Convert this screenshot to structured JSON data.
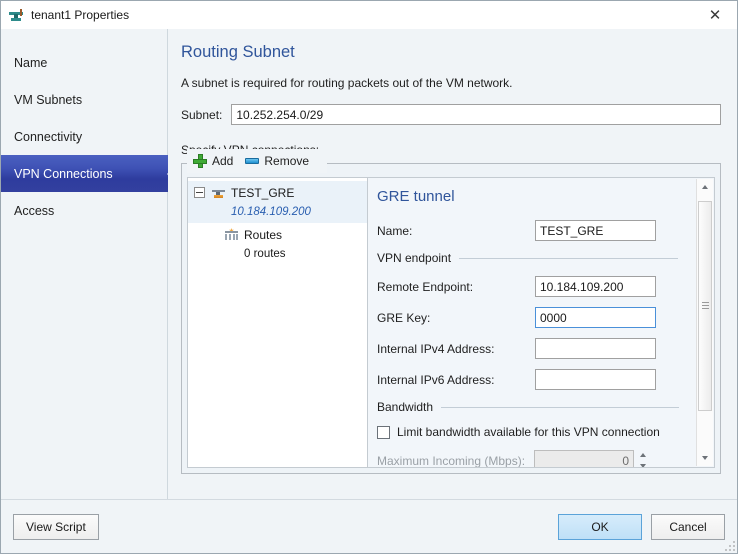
{
  "window": {
    "title": "tenant1 Properties",
    "icon": "network-tenant-icon",
    "close_label": "✕"
  },
  "sidebar": {
    "items": [
      {
        "label": "Name",
        "selected": false
      },
      {
        "label": "VM Subnets",
        "selected": false
      },
      {
        "label": "Connectivity",
        "selected": false
      },
      {
        "label": "VPN Connections",
        "selected": true
      },
      {
        "label": "Access",
        "selected": false
      }
    ]
  },
  "main": {
    "page_title": "Routing Subnet",
    "description": "A subnet is required for routing packets out of the VM network.",
    "subnet": {
      "label": "Subnet:",
      "value": "10.252.254.0/29",
      "placeholder": ""
    },
    "specify_label": "Specify VPN connections:",
    "toolbar": {
      "add_label": "Add",
      "add_icon": "plus-icon",
      "remove_label": "Remove",
      "remove_icon": "minus-icon"
    }
  },
  "tree": {
    "nodes": [
      {
        "label": "TEST_GRE",
        "sublabel": "10.184.109.200",
        "icon": "gre-tunnel-icon",
        "expander": "collapse-icon",
        "selected": true
      },
      {
        "label": "Routes",
        "sublabel": "0 routes",
        "icon": "routes-icon",
        "selected": false
      }
    ]
  },
  "detail": {
    "title": "GRE tunnel",
    "name_field": {
      "label": "Name:",
      "value": "TEST_GRE",
      "placeholder": ""
    },
    "vpn_endpoint_section": "VPN endpoint",
    "remote_endpoint": {
      "label": "Remote Endpoint:",
      "value": "10.184.109.200",
      "placeholder": ""
    },
    "gre_key": {
      "label": "GRE Key:",
      "value": "0000",
      "placeholder": ""
    },
    "internal_ipv4": {
      "label": "Internal IPv4 Address:",
      "value": "",
      "placeholder": ""
    },
    "internal_ipv6": {
      "label": "Internal IPv6 Address:",
      "value": "",
      "placeholder": ""
    },
    "bandwidth_section": "Bandwidth",
    "limit_checkbox": {
      "label": "Limit bandwidth available for this VPN connection",
      "checked": false
    },
    "max_incoming": {
      "label": "Maximum Incoming (Mbps):",
      "value": "0",
      "disabled": true
    }
  },
  "footer": {
    "view_script_label": "View Script",
    "ok_label": "OK",
    "cancel_label": "Cancel"
  },
  "colors": {
    "accent_heading": "#30559b",
    "selected_nav_start": "#4a60c0",
    "selected_nav_end": "#33409f",
    "focus_border": "#4a90d9",
    "tree_sub_link": "#2a5fb0",
    "add_icon_green": "#3faa35",
    "remove_icon_blue": "#1e8fd0"
  }
}
